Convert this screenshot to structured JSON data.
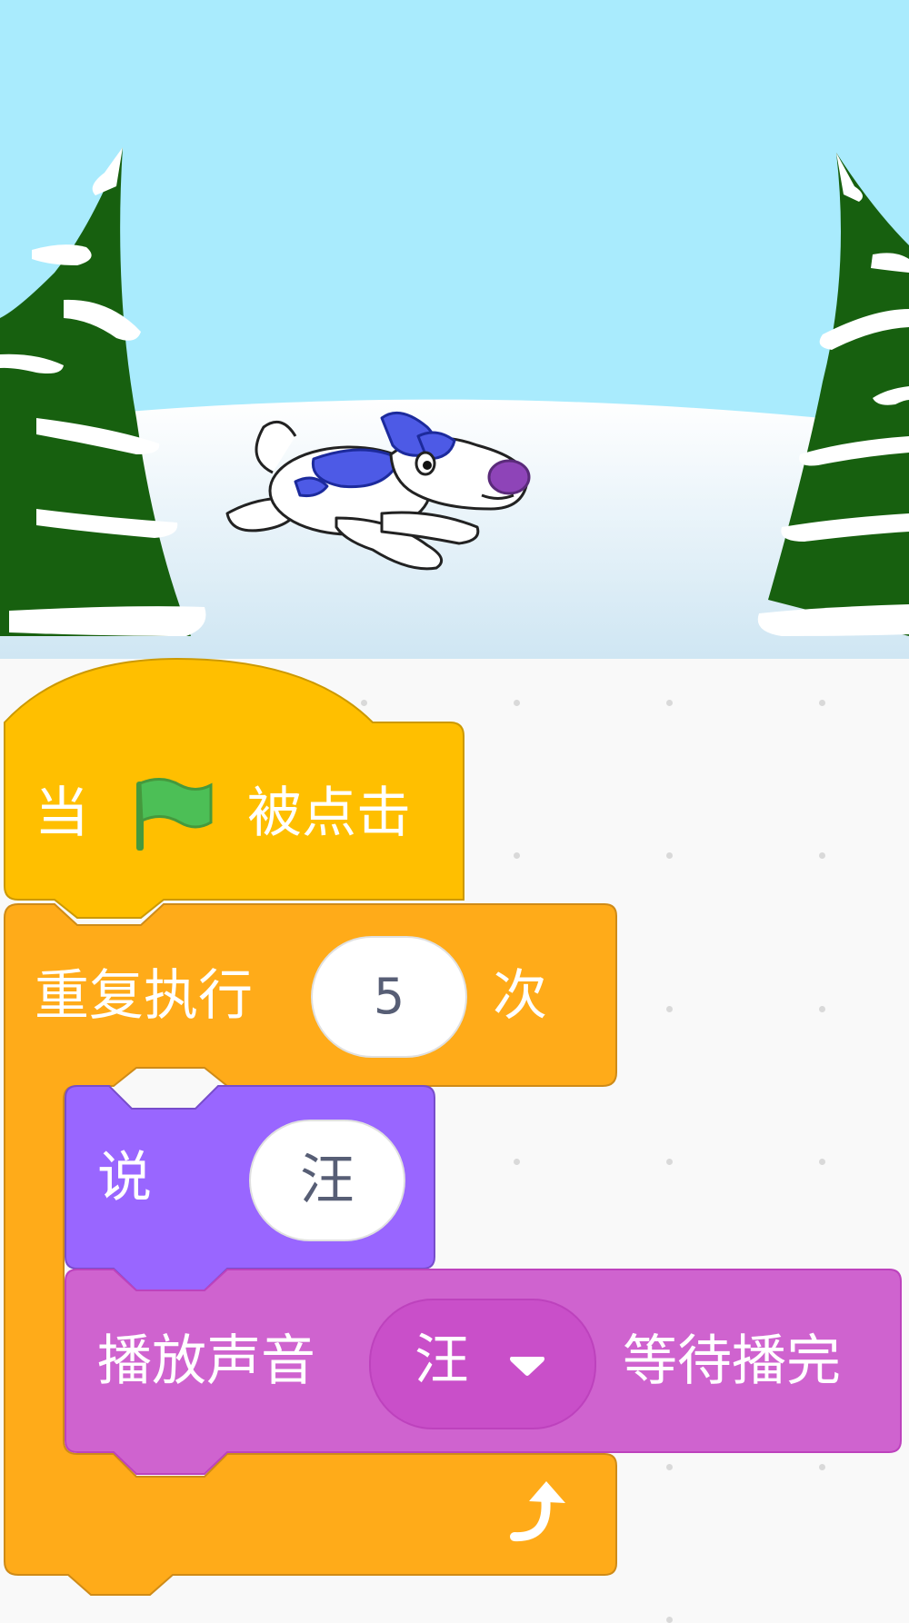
{
  "stage": {
    "sprite_name": "dog",
    "backdrop": "winter-snow-with-pine-trees"
  },
  "script": {
    "hat_block": {
      "prefix": "当",
      "icon": "green-flag-icon",
      "suffix": "被点击",
      "color": "#ffbf00"
    },
    "repeat_block": {
      "label": "重复执行",
      "count": "5",
      "unit": "次",
      "loop_icon": "loop-arrow-icon",
      "color": "#ffab19"
    },
    "say_block": {
      "label": "说",
      "message": "汪",
      "color": "#9966ff"
    },
    "sound_block": {
      "label": "播放声音",
      "sound": "汪",
      "dropdown_icon": "dropdown-arrow-icon",
      "suffix": "等待播完",
      "color": "#cf63cf"
    }
  }
}
